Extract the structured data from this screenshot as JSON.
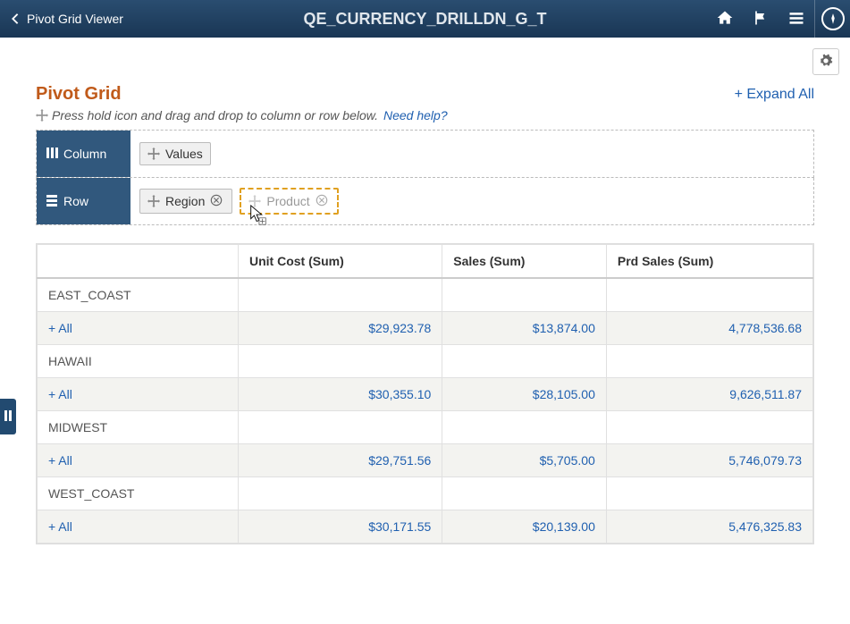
{
  "banner": {
    "back_label": "Pivot Grid Viewer",
    "title": "QE_CURRENCY_DRILLDN_G_T"
  },
  "page": {
    "title": "Pivot Grid",
    "expand_all": "+ Expand All",
    "hint": "Press hold icon and drag and drop to column or row below.",
    "need_help": "Need help?"
  },
  "config": {
    "column_label": "Column",
    "row_label": "Row",
    "column_chips": {
      "values": "Values"
    },
    "row_chips": {
      "region": "Region",
      "product": "Product"
    }
  },
  "grid": {
    "headers": {
      "blank": "",
      "unit_cost": "Unit Cost (Sum)",
      "sales": "Sales (Sum)",
      "prd_sales": "Prd Sales (Sum)"
    },
    "all_label": "+ All",
    "rows": [
      {
        "region": "EAST_COAST",
        "unit_cost": "$29,923.78",
        "sales": "$13,874.00",
        "prd_sales": "4,778,536.68"
      },
      {
        "region": "HAWAII",
        "unit_cost": "$30,355.10",
        "sales": "$28,105.00",
        "prd_sales": "9,626,511.87"
      },
      {
        "region": "MIDWEST",
        "unit_cost": "$29,751.56",
        "sales": "$5,705.00",
        "prd_sales": "5,746,079.73"
      },
      {
        "region": "WEST_COAST",
        "unit_cost": "$30,171.55",
        "sales": "$20,139.00",
        "prd_sales": "5,476,325.83"
      }
    ]
  }
}
